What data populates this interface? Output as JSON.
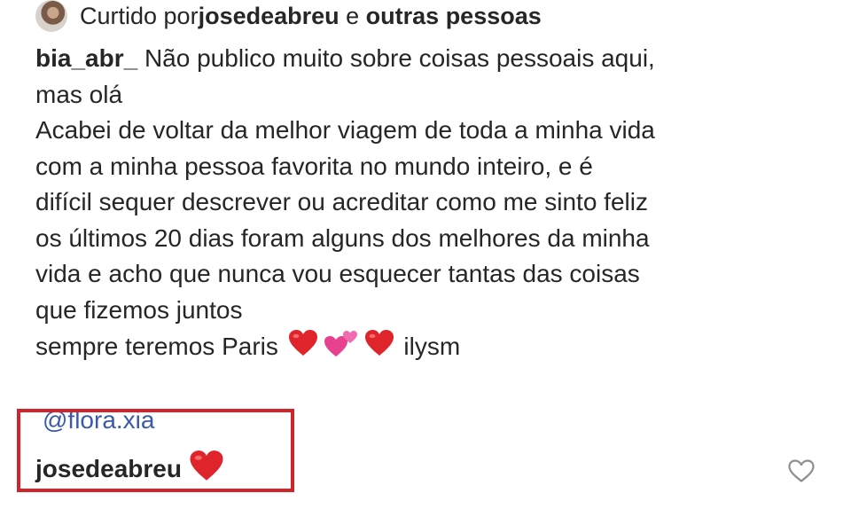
{
  "likes": {
    "prefix": "Curtido por ",
    "user": "josedeabreu",
    "conj": " e ",
    "others": "outras pessoas"
  },
  "caption": {
    "username": "bia_abr_",
    "line1_text": " Não publico muito sobre coisas pessoais aqui,",
    "lines": [
      "mas olá",
      "Acabei de voltar da melhor viagem de toda a minha vida",
      "com a minha pessoa favorita no mundo inteiro, e é",
      "difícil sequer descrever ou acreditar como me sinto feliz",
      "os últimos 20 dias foram alguns dos melhores da minha",
      "vida e acho que nunca vou esquecer tantas das coisas",
      "que fizemos juntos"
    ],
    "last_line_text": "sempre teremos Paris ",
    "last_line_end": " ilysm"
  },
  "comment": {
    "mention": "@flora.xia",
    "username": "josedeabreu"
  },
  "colors": {
    "highlight": "#d2232a",
    "mention": "#3b5ba9",
    "heart": "#e0242b"
  }
}
